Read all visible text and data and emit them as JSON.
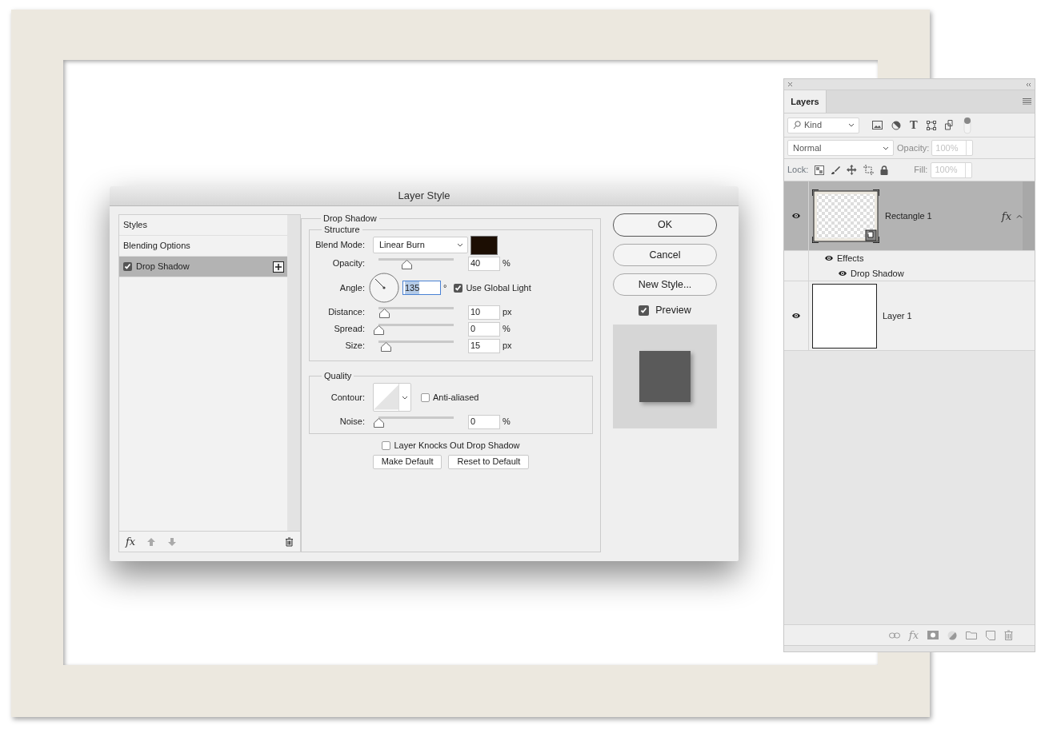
{
  "dialog": {
    "title": "Layer Style",
    "styles_list": {
      "items": [
        {
          "label": "Styles",
          "kind": "header",
          "selected": false
        },
        {
          "label": "Blending Options",
          "kind": "plain",
          "selected": false
        },
        {
          "label": "Drop Shadow",
          "kind": "effect",
          "checked": true,
          "selected": true
        }
      ],
      "add_style_button": "fx"
    },
    "drop_shadow": {
      "title": "Drop Shadow",
      "structure": {
        "title": "Structure",
        "blend_mode": {
          "label": "Blend Mode:",
          "value": "Linear Burn",
          "color": "#1c0e03"
        },
        "opacity": {
          "label": "Opacity:",
          "level": 0.38,
          "value": "40",
          "unit": "%"
        },
        "angle": {
          "label": "Angle:",
          "value": "135",
          "text_selected": true,
          "unit": "°",
          "global_light": {
            "label": "Use Global Light",
            "checked": true
          }
        },
        "sliders": [
          {
            "label": "Distance:",
            "level": 0.08,
            "value": "10",
            "unit": "px"
          },
          {
            "label": "Spread:",
            "level": 0,
            "value": "0",
            "unit": "%"
          },
          {
            "label": "Size:",
            "level": 0.1,
            "value": "15",
            "unit": "px"
          }
        ]
      },
      "quality": {
        "title": "Quality",
        "contour": {
          "label": "Contour:",
          "anti_aliased": {
            "label": "Anti-aliased",
            "checked": false
          }
        },
        "noise": {
          "label": "Noise:",
          "level": 0,
          "value": "0",
          "unit": "%"
        }
      },
      "knockout": {
        "label": "Layer Knocks Out Drop Shadow",
        "checked": false
      },
      "buttons": [
        "Make Default",
        "Reset to Default"
      ]
    },
    "buttons": [
      {
        "label": "OK",
        "default": true
      },
      {
        "label": "Cancel",
        "default": false
      },
      {
        "label": "New Style...",
        "default": false
      }
    ],
    "preview": {
      "label": "Preview",
      "checked": true
    }
  },
  "layers_panel": {
    "tabs": [
      {
        "label": "Layers",
        "selected": true
      }
    ],
    "filter": {
      "value": "Kind",
      "type_icon": "T",
      "toggle_on": true
    },
    "blend_mode": {
      "value": "Normal",
      "disabled": false
    },
    "opacity": {
      "label": "Opacity:",
      "value": "100%",
      "disabled": true
    },
    "lock": {
      "label": "Lock:"
    },
    "fill": {
      "label": "Fill:",
      "value": "100%",
      "disabled": true
    },
    "layers": [
      {
        "name": "Rectangle 1",
        "kind": "shape",
        "selected": true,
        "visible": true,
        "effects_badge": "fx",
        "expanded": true,
        "effects": {
          "label": "Effects",
          "visible": true,
          "children": [
            {
              "label": "Drop Shadow",
              "visible": true
            }
          ]
        }
      },
      {
        "name": "Layer 1",
        "kind": "pixel",
        "selected": false,
        "visible": true
      }
    ],
    "footer_fx": "fx"
  }
}
